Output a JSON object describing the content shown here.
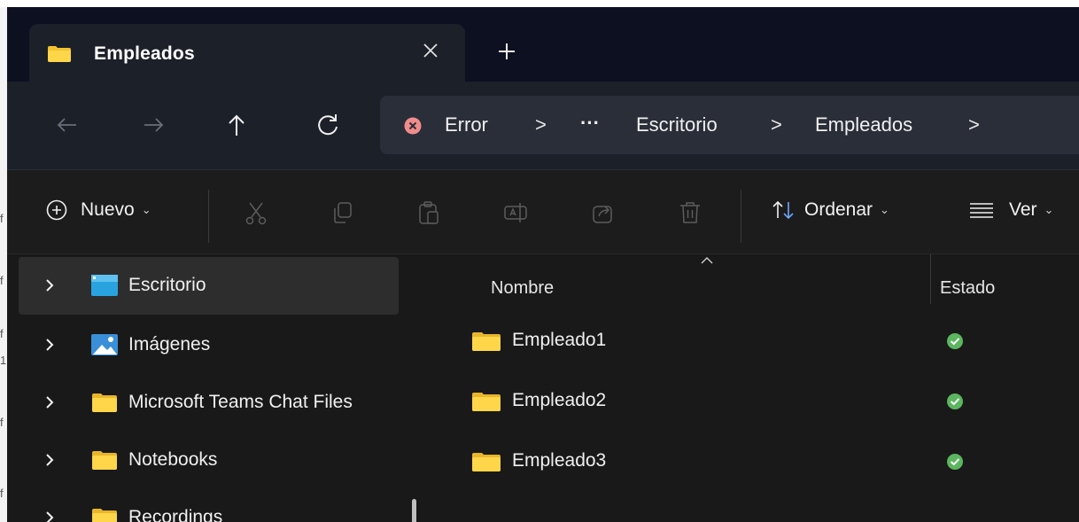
{
  "tab": {
    "title": "Empleados",
    "close_icon": "close-icon",
    "new_tab_icon": "plus-icon"
  },
  "nav": {
    "back_icon": "arrow-left-icon",
    "forward_icon": "arrow-right-icon",
    "up_icon": "arrow-up-icon",
    "refresh_icon": "refresh-icon"
  },
  "address": {
    "error_label": "Error",
    "ellipsis": "···",
    "crumbs": [
      "Escritorio",
      "Empleados"
    ],
    "separator": ">"
  },
  "commands": {
    "new_label": "Nuevo",
    "sort_label": "Ordenar",
    "view_label": "Ver",
    "caret": "⌄",
    "icons": [
      "cut-icon",
      "copy-icon",
      "paste-icon",
      "rename-icon",
      "share-icon",
      "delete-icon"
    ]
  },
  "sidebar": {
    "items": [
      {
        "label": "Escritorio",
        "icon": "desktop-icon",
        "selected": true
      },
      {
        "label": "Imágenes",
        "icon": "pictures-icon"
      },
      {
        "label": "Microsoft Teams Chat Files",
        "icon": "folder-icon"
      },
      {
        "label": "Notebooks",
        "icon": "folder-icon"
      },
      {
        "label": "Recordings",
        "icon": "folder-icon"
      }
    ]
  },
  "files": {
    "columns": {
      "name": "Nombre",
      "status": "Estado"
    },
    "rows": [
      {
        "name": "Empleado1",
        "status_icon": "synced-check-icon"
      },
      {
        "name": "Empleado2",
        "status_icon": "synced-check-icon"
      },
      {
        "name": "Empleado3",
        "status_icon": "synced-check-icon"
      }
    ]
  },
  "colors": {
    "folder": "#f4c430",
    "status_ok": "#5bb65f",
    "error": "#f08c8c",
    "background": "#191919"
  }
}
